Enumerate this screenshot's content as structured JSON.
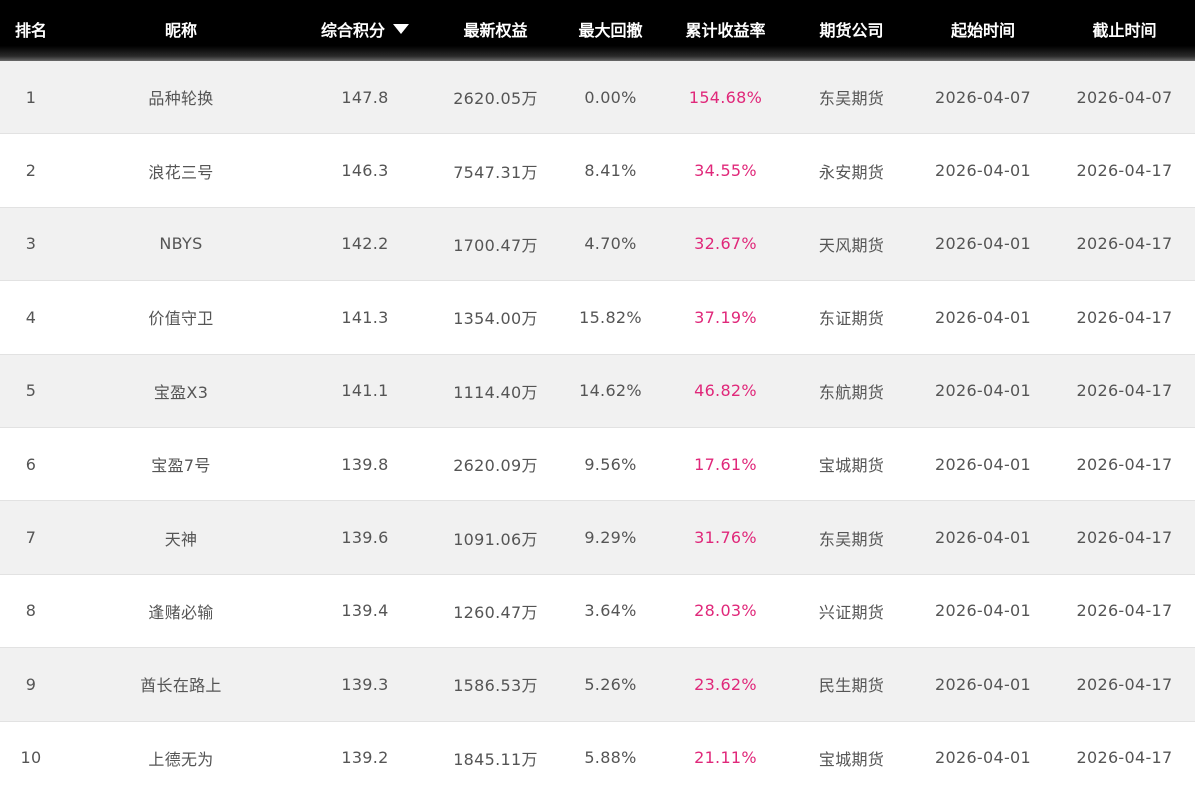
{
  "header": {
    "rank": "排名",
    "nickname": "昵称",
    "score": "综合积分",
    "equity": "最新权益",
    "drawdown": "最大回撤",
    "return": "累计收益率",
    "company": "期货公司",
    "start": "起始时间",
    "end": "截止时间"
  },
  "sort_indicator": "caret-down-icon",
  "colors": {
    "return_text": "#e0287a",
    "header_bg": "#000000"
  },
  "rows": [
    {
      "rank": "1",
      "nickname": "品种轮换",
      "score": "147.8",
      "equity": "2620.05万",
      "drawdown": "0.00%",
      "return": "154.68%",
      "company": "东吴期货",
      "start": "2026-04-07",
      "end": "2026-04-07"
    },
    {
      "rank": "2",
      "nickname": "浪花三号",
      "score": "146.3",
      "equity": "7547.31万",
      "drawdown": "8.41%",
      "return": "34.55%",
      "company": "永安期货",
      "start": "2026-04-01",
      "end": "2026-04-17"
    },
    {
      "rank": "3",
      "nickname": "NBYS",
      "score": "142.2",
      "equity": "1700.47万",
      "drawdown": "4.70%",
      "return": "32.67%",
      "company": "天风期货",
      "start": "2026-04-01",
      "end": "2026-04-17"
    },
    {
      "rank": "4",
      "nickname": "价值守卫",
      "score": "141.3",
      "equity": "1354.00万",
      "drawdown": "15.82%",
      "return": "37.19%",
      "company": "东证期货",
      "start": "2026-04-01",
      "end": "2026-04-17"
    },
    {
      "rank": "5",
      "nickname": "宝盈X3",
      "score": "141.1",
      "equity": "1114.40万",
      "drawdown": "14.62%",
      "return": "46.82%",
      "company": "东航期货",
      "start": "2026-04-01",
      "end": "2026-04-17"
    },
    {
      "rank": "6",
      "nickname": "宝盈7号",
      "score": "139.8",
      "equity": "2620.09万",
      "drawdown": "9.56%",
      "return": "17.61%",
      "company": "宝城期货",
      "start": "2026-04-01",
      "end": "2026-04-17"
    },
    {
      "rank": "7",
      "nickname": "天神",
      "score": "139.6",
      "equity": "1091.06万",
      "drawdown": "9.29%",
      "return": "31.76%",
      "company": "东吴期货",
      "start": "2026-04-01",
      "end": "2026-04-17"
    },
    {
      "rank": "8",
      "nickname": "逢赌必输",
      "score": "139.4",
      "equity": "1260.47万",
      "drawdown": "3.64%",
      "return": "28.03%",
      "company": "兴证期货",
      "start": "2026-04-01",
      "end": "2026-04-17"
    },
    {
      "rank": "9",
      "nickname": "酋长在路上",
      "score": "139.3",
      "equity": "1586.53万",
      "drawdown": "5.26%",
      "return": "23.62%",
      "company": "民生期货",
      "start": "2026-04-01",
      "end": "2026-04-17"
    },
    {
      "rank": "10",
      "nickname": "上德无为",
      "score": "139.2",
      "equity": "1845.11万",
      "drawdown": "5.88%",
      "return": "21.11%",
      "company": "宝城期货",
      "start": "2026-04-01",
      "end": "2026-04-17"
    }
  ]
}
